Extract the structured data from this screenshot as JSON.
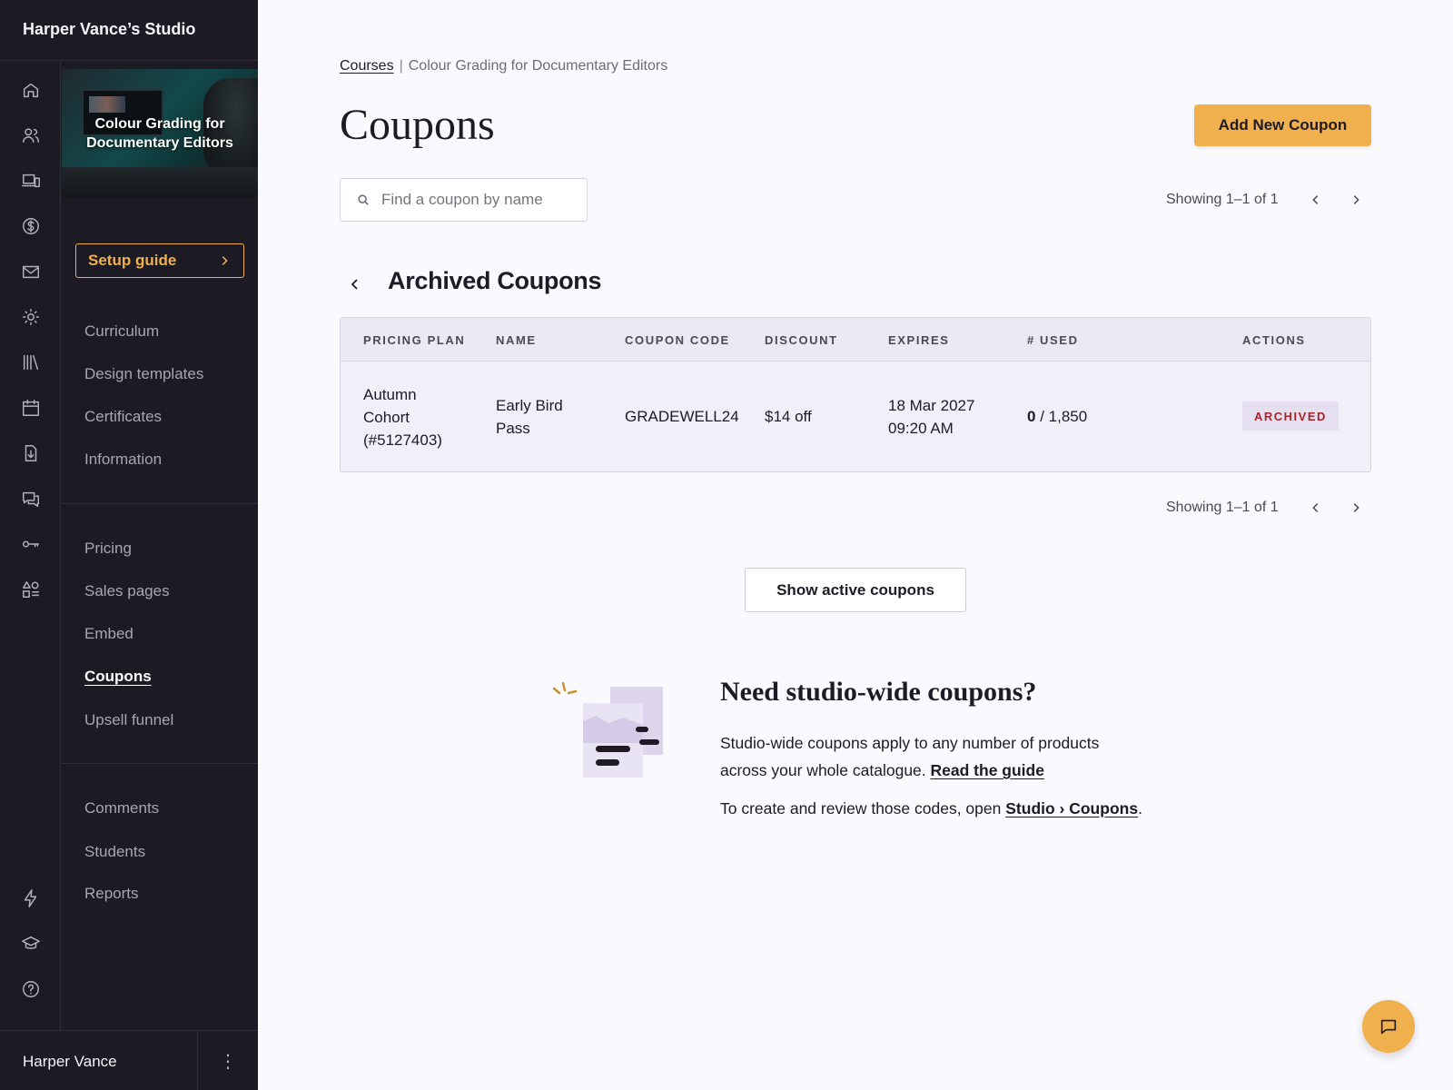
{
  "studio": {
    "name": "Harper Vance’s Studio"
  },
  "course_card": {
    "title": "Colour Grading for Documentary Editors"
  },
  "setup_guide": {
    "label": "Setup guide"
  },
  "nav": {
    "group1": [
      "Curriculum",
      "Design templates",
      "Certificates",
      "Information"
    ],
    "group2": [
      "Pricing",
      "Sales pages",
      "Embed",
      "Coupons",
      "Upsell funnel"
    ],
    "group3": [
      "Comments",
      "Students",
      "Reports"
    ],
    "active": "Coupons"
  },
  "rail_icons": [
    "home-icon",
    "users-icon",
    "devices-icon",
    "dollar-icon",
    "mail-icon",
    "sun-icon",
    "library-icon",
    "calendar-icon",
    "download-doc-icon",
    "chat-icon",
    "key-icon",
    "shapes-icon",
    "lightning-icon",
    "graduation-cap-icon",
    "help-icon"
  ],
  "user": {
    "name": "Harper Vance",
    "menu_glyph": "⋮"
  },
  "breadcrumb": {
    "root": "Courses",
    "separator": "|",
    "current": "Colour Grading for Documentary Editors"
  },
  "page": {
    "title": "Coupons",
    "add_button": "Add New Coupon"
  },
  "search": {
    "placeholder": "Find a coupon by name",
    "value": ""
  },
  "pagination": {
    "text": "Showing 1–1 of 1"
  },
  "section": {
    "title": "Archived Coupons"
  },
  "table": {
    "headers": [
      "PRICING PLAN",
      "NAME",
      "COUPON CODE",
      "DISCOUNT",
      "EXPIRES",
      "# USED",
      "ACTIONS"
    ],
    "rows": [
      {
        "plan": [
          "Autumn",
          "Cohort",
          "(#5127403)"
        ],
        "name": [
          "Early Bird",
          "Pass"
        ],
        "code": "GRADEWELL24",
        "discount": "$14 off",
        "expires": [
          "18 Mar 2027",
          "09:20 AM"
        ],
        "used": "0",
        "used_total": "/ 1,850",
        "status": "ARCHIVED"
      }
    ]
  },
  "show_active_button": "Show active coupons",
  "promo": {
    "title": "Need studio-wide coupons?",
    "p1_text": "Studio-wide coupons apply to any number of products across your whole catalogue.",
    "p1_link": "Read the guide",
    "p2_text": "To create and review those codes, open",
    "p2_link": "Studio › Coupons",
    "p2_end": "."
  },
  "colors": {
    "accent": "#f0b04d",
    "sidebar_bg": "#1c1a22",
    "archived": "#a8232b",
    "page_bg": "#faf9fd"
  }
}
